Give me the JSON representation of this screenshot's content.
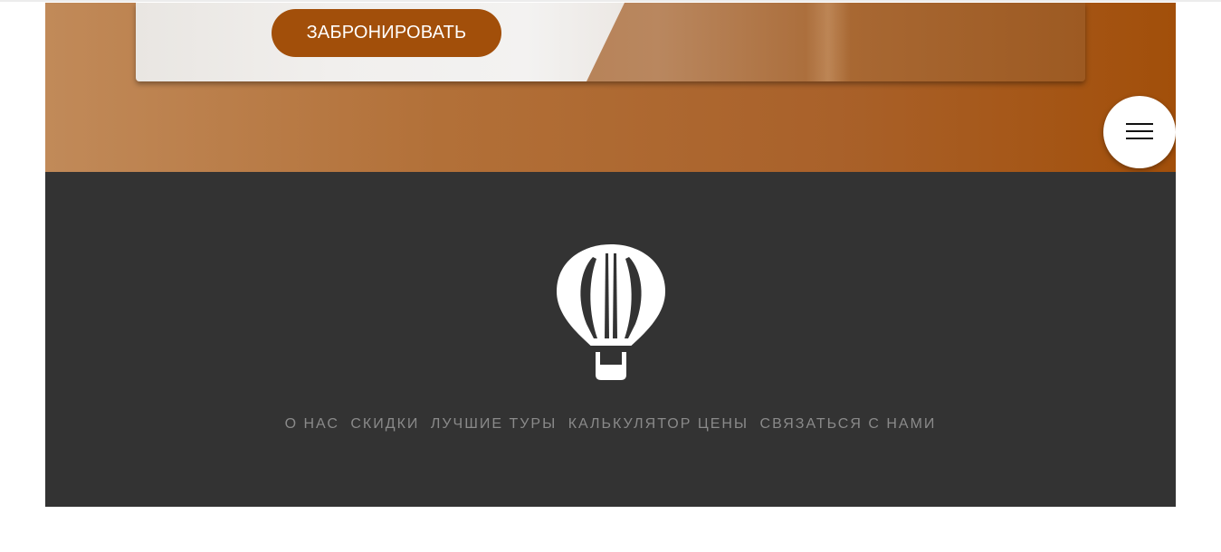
{
  "hero": {
    "book_button_label": "ЗАБРОНИРОВАТЬ",
    "menu_icon": "hamburger-menu-icon"
  },
  "footer": {
    "logo_icon": "hot-air-balloon-icon",
    "nav": [
      {
        "label": "О НАС"
      },
      {
        "label": "СКИДКИ"
      },
      {
        "label": "ЛУЧШИЕ ТУРЫ"
      },
      {
        "label": "КАЛЬКУЛЯТОР ЦЕНЫ"
      },
      {
        "label": "СВЯЗАТЬСЯ С НАМИ"
      }
    ]
  },
  "colors": {
    "accent": "#a24f0a",
    "footer_bg": "#333333",
    "nav_text": "#8a8a8a"
  }
}
